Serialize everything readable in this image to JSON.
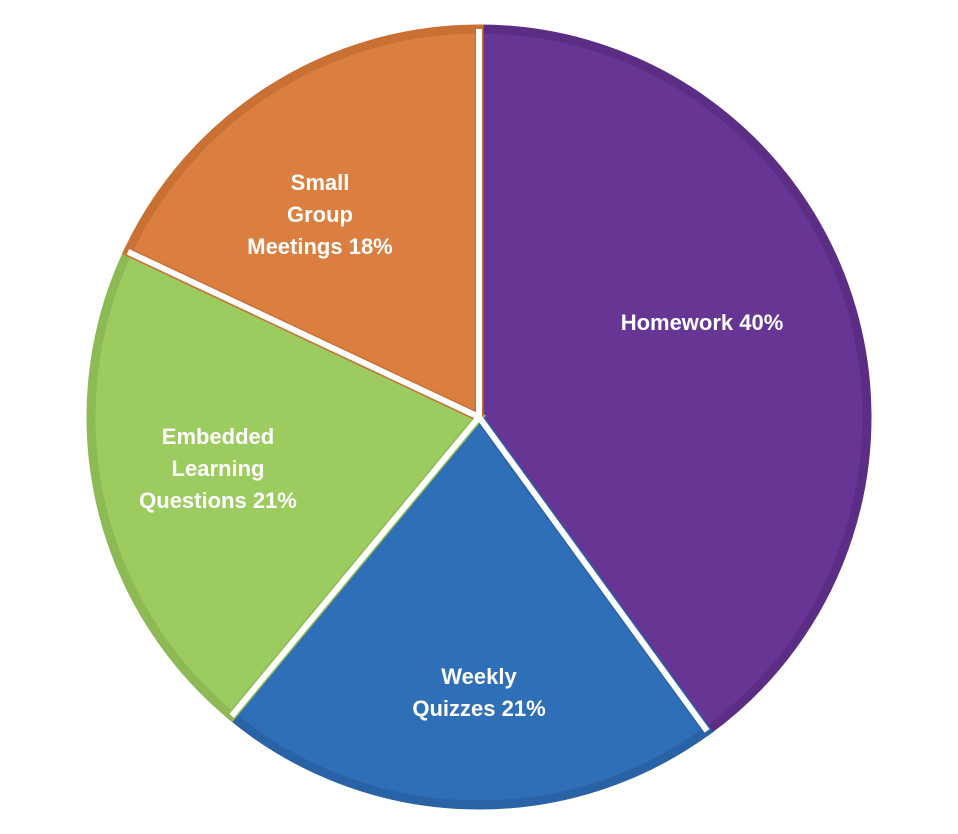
{
  "chart_data": {
    "type": "pie",
    "title": "",
    "start_angle_deg": 0,
    "direction": "clockwise",
    "legend": "none",
    "slices": [
      {
        "label": "Homework 40%",
        "label_lines": [
          "Homework 40%"
        ],
        "value": 40,
        "color": "#673695",
        "border_color": "#5b2d85"
      },
      {
        "label": "Weekly Quizzes 21%",
        "label_lines": [
          "Weekly",
          "Quizzes 21%"
        ],
        "value": 21,
        "color": "#2f6fb8",
        "border_color": "#2a62a6"
      },
      {
        "label": "Embedded Learning Questions 21%",
        "label_lines": [
          "Embedded",
          "Learning",
          "Questions 21%"
        ],
        "value": 21,
        "color": "#9ccb60",
        "border_color": "#8dba54"
      },
      {
        "label": "Small Group Meetings 18%",
        "label_lines": [
          "Small",
          "Group",
          "Meetings 18%"
        ],
        "value": 18,
        "color": "#db7f40",
        "border_color": "#c97134"
      }
    ]
  }
}
